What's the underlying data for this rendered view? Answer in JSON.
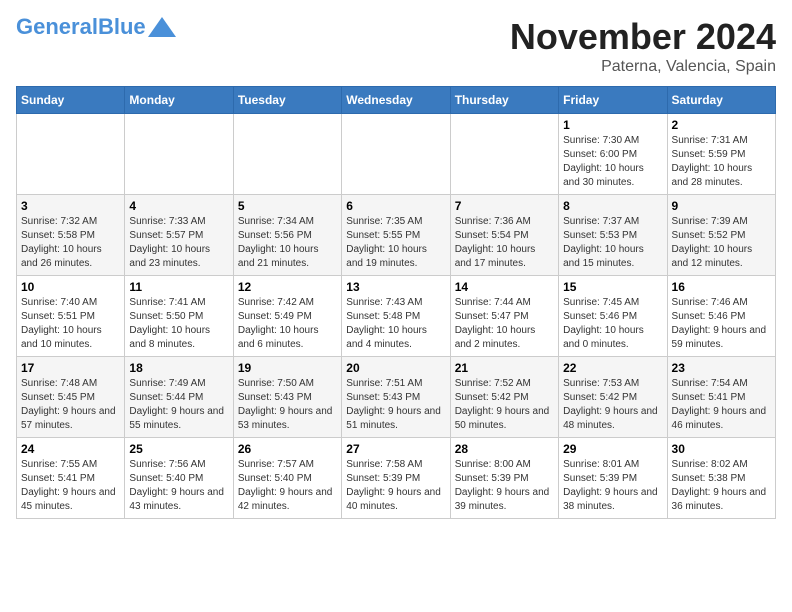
{
  "header": {
    "logo_general": "General",
    "logo_blue": "Blue",
    "month_title": "November 2024",
    "location": "Paterna, Valencia, Spain"
  },
  "calendar": {
    "days_of_week": [
      "Sunday",
      "Monday",
      "Tuesday",
      "Wednesday",
      "Thursday",
      "Friday",
      "Saturday"
    ],
    "weeks": [
      [
        {
          "day": "",
          "info": ""
        },
        {
          "day": "",
          "info": ""
        },
        {
          "day": "",
          "info": ""
        },
        {
          "day": "",
          "info": ""
        },
        {
          "day": "",
          "info": ""
        },
        {
          "day": "1",
          "info": "Sunrise: 7:30 AM\nSunset: 6:00 PM\nDaylight: 10 hours and 30 minutes."
        },
        {
          "day": "2",
          "info": "Sunrise: 7:31 AM\nSunset: 5:59 PM\nDaylight: 10 hours and 28 minutes."
        }
      ],
      [
        {
          "day": "3",
          "info": "Sunrise: 7:32 AM\nSunset: 5:58 PM\nDaylight: 10 hours and 26 minutes."
        },
        {
          "day": "4",
          "info": "Sunrise: 7:33 AM\nSunset: 5:57 PM\nDaylight: 10 hours and 23 minutes."
        },
        {
          "day": "5",
          "info": "Sunrise: 7:34 AM\nSunset: 5:56 PM\nDaylight: 10 hours and 21 minutes."
        },
        {
          "day": "6",
          "info": "Sunrise: 7:35 AM\nSunset: 5:55 PM\nDaylight: 10 hours and 19 minutes."
        },
        {
          "day": "7",
          "info": "Sunrise: 7:36 AM\nSunset: 5:54 PM\nDaylight: 10 hours and 17 minutes."
        },
        {
          "day": "8",
          "info": "Sunrise: 7:37 AM\nSunset: 5:53 PM\nDaylight: 10 hours and 15 minutes."
        },
        {
          "day": "9",
          "info": "Sunrise: 7:39 AM\nSunset: 5:52 PM\nDaylight: 10 hours and 12 minutes."
        }
      ],
      [
        {
          "day": "10",
          "info": "Sunrise: 7:40 AM\nSunset: 5:51 PM\nDaylight: 10 hours and 10 minutes."
        },
        {
          "day": "11",
          "info": "Sunrise: 7:41 AM\nSunset: 5:50 PM\nDaylight: 10 hours and 8 minutes."
        },
        {
          "day": "12",
          "info": "Sunrise: 7:42 AM\nSunset: 5:49 PM\nDaylight: 10 hours and 6 minutes."
        },
        {
          "day": "13",
          "info": "Sunrise: 7:43 AM\nSunset: 5:48 PM\nDaylight: 10 hours and 4 minutes."
        },
        {
          "day": "14",
          "info": "Sunrise: 7:44 AM\nSunset: 5:47 PM\nDaylight: 10 hours and 2 minutes."
        },
        {
          "day": "15",
          "info": "Sunrise: 7:45 AM\nSunset: 5:46 PM\nDaylight: 10 hours and 0 minutes."
        },
        {
          "day": "16",
          "info": "Sunrise: 7:46 AM\nSunset: 5:46 PM\nDaylight: 9 hours and 59 minutes."
        }
      ],
      [
        {
          "day": "17",
          "info": "Sunrise: 7:48 AM\nSunset: 5:45 PM\nDaylight: 9 hours and 57 minutes."
        },
        {
          "day": "18",
          "info": "Sunrise: 7:49 AM\nSunset: 5:44 PM\nDaylight: 9 hours and 55 minutes."
        },
        {
          "day": "19",
          "info": "Sunrise: 7:50 AM\nSunset: 5:43 PM\nDaylight: 9 hours and 53 minutes."
        },
        {
          "day": "20",
          "info": "Sunrise: 7:51 AM\nSunset: 5:43 PM\nDaylight: 9 hours and 51 minutes."
        },
        {
          "day": "21",
          "info": "Sunrise: 7:52 AM\nSunset: 5:42 PM\nDaylight: 9 hours and 50 minutes."
        },
        {
          "day": "22",
          "info": "Sunrise: 7:53 AM\nSunset: 5:42 PM\nDaylight: 9 hours and 48 minutes."
        },
        {
          "day": "23",
          "info": "Sunrise: 7:54 AM\nSunset: 5:41 PM\nDaylight: 9 hours and 46 minutes."
        }
      ],
      [
        {
          "day": "24",
          "info": "Sunrise: 7:55 AM\nSunset: 5:41 PM\nDaylight: 9 hours and 45 minutes."
        },
        {
          "day": "25",
          "info": "Sunrise: 7:56 AM\nSunset: 5:40 PM\nDaylight: 9 hours and 43 minutes."
        },
        {
          "day": "26",
          "info": "Sunrise: 7:57 AM\nSunset: 5:40 PM\nDaylight: 9 hours and 42 minutes."
        },
        {
          "day": "27",
          "info": "Sunrise: 7:58 AM\nSunset: 5:39 PM\nDaylight: 9 hours and 40 minutes."
        },
        {
          "day": "28",
          "info": "Sunrise: 8:00 AM\nSunset: 5:39 PM\nDaylight: 9 hours and 39 minutes."
        },
        {
          "day": "29",
          "info": "Sunrise: 8:01 AM\nSunset: 5:39 PM\nDaylight: 9 hours and 38 minutes."
        },
        {
          "day": "30",
          "info": "Sunrise: 8:02 AM\nSunset: 5:38 PM\nDaylight: 9 hours and 36 minutes."
        }
      ]
    ]
  }
}
